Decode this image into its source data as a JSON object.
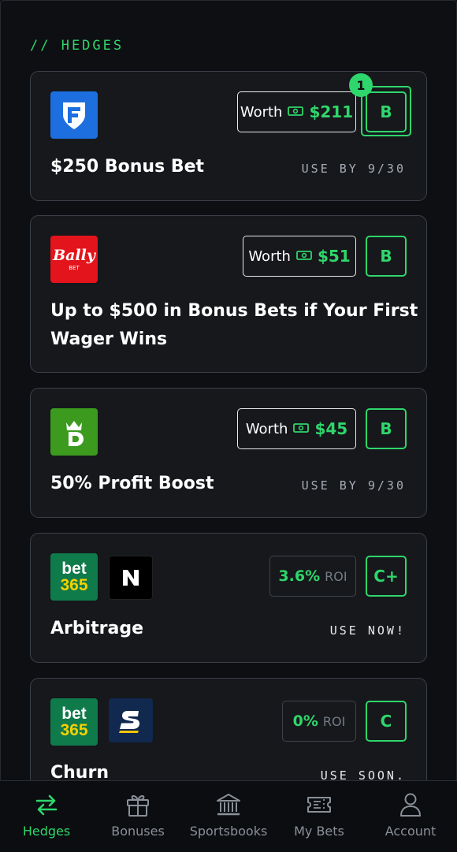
{
  "section_title": "// HEDGES",
  "cards": [
    {
      "logos": [
        "fanduel"
      ],
      "worth_label": "Worth",
      "worth_amount": "$211",
      "grade": "B",
      "badge": "1",
      "title": "$250 Bonus Bet",
      "use_by": "USE BY 9/30"
    },
    {
      "logos": [
        "bally-bet"
      ],
      "logo_text": "Bally",
      "logo_subtext": "BET",
      "worth_label": "Worth",
      "worth_amount": "$51",
      "grade": "B",
      "title_line1": "Up to $500 in Bonus Bets if Your First",
      "title_line2": "Wager Wins"
    },
    {
      "logos": [
        "draftkings"
      ],
      "worth_label": "Worth",
      "worth_amount": "$45",
      "grade": "B",
      "title": "50% Profit Boost",
      "use_by": "USE BY 9/30"
    },
    {
      "logos": [
        "bet365",
        "novig"
      ],
      "bet365_top": "bet",
      "bet365_bottom": "365",
      "roi_value": "3.6%",
      "roi_unit": "ROI",
      "grade": "C+",
      "title": "Arbitrage",
      "use_by": "USE NOW!"
    },
    {
      "logos": [
        "bet365",
        "sports-illustrated"
      ],
      "bet365_top": "bet",
      "bet365_bottom": "365",
      "roi_value": "0%",
      "roi_unit": "ROI",
      "grade": "C",
      "title": "Churn",
      "use_by": "USE SOON."
    }
  ],
  "tabs": [
    {
      "label": "Hedges",
      "icon": "swap-arrows-icon",
      "active": true
    },
    {
      "label": "Bonuses",
      "icon": "gift-icon",
      "active": false
    },
    {
      "label": "Sportsbooks",
      "icon": "bank-icon",
      "active": false
    },
    {
      "label": "My Bets",
      "icon": "ticket-icon",
      "active": false
    },
    {
      "label": "Account",
      "icon": "user-icon",
      "active": false
    }
  ],
  "colors": {
    "accent": "#2fd66b",
    "background": "#0e0f12",
    "card": "#16181c",
    "card_border": "#3a4049"
  }
}
